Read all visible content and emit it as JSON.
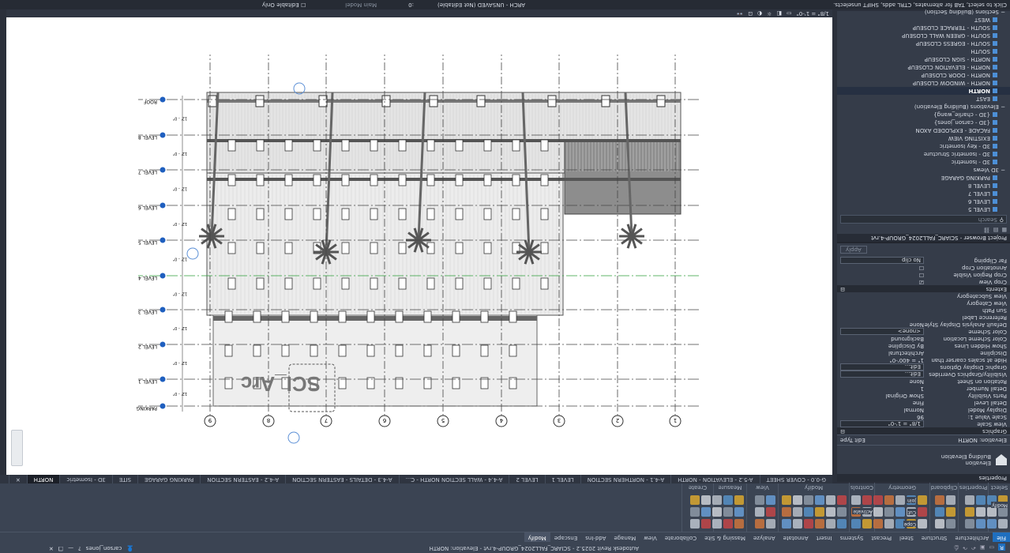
{
  "titlebar": {
    "title": "Autodesk Revit 2025.2 - SCIARC_FALL2024_GROUP-4.rvt - Elevation: NORTH",
    "user": "carson_jones"
  },
  "ribbon": {
    "tabs": [
      "File",
      "Architecture",
      "Structure",
      "Steel",
      "Precast",
      "Systems",
      "Insert",
      "Annotate",
      "Analyze",
      "Massing & Site",
      "Collaborate",
      "View",
      "Manage",
      "Add-Ins",
      "Enscape",
      "Modify"
    ],
    "active_tab": "Modify",
    "panels": [
      "Select",
      "Properties",
      "Clipboard",
      "Geometry",
      "Controls",
      "Modify",
      "View",
      "Measure",
      "Create"
    ],
    "labels": {
      "modify": "Modify",
      "cope": "Cope",
      "cut": "Cut",
      "join": "Join",
      "activate": "Activate"
    }
  },
  "view_tabs": [
    "G-0.0 - COVER SHEET",
    "A-5.2 - ELEVATION - NORTH",
    "A-4.1 - NORTHERN SECTION",
    "LEVEL 1",
    "LEVEL 2",
    "A-4.4 - WALL SECTION NORTH - C...",
    "A-4.3 - DETAILS - EASTERN SECTION",
    "A-4.2 - EASTERN SECTION",
    "PARKING GARAGE",
    "SITE",
    "3D - Isometric",
    "NORTH"
  ],
  "properties": {
    "header": "Properties",
    "type_family": "Elevation",
    "type_name": "Building Elevation",
    "instance": "Elevation: NORTH",
    "edit_type": "Edit Type",
    "sections": {
      "graphics": "Graphics",
      "extents": "Extents"
    },
    "graphics": [
      [
        "View Scale",
        "1/8\" = 1'-0\""
      ],
      [
        "Scale Value  1:",
        "96"
      ],
      [
        "Display Model",
        "Normal"
      ],
      [
        "Detail Level",
        "Fine"
      ],
      [
        "Parts Visibility",
        "Show Original"
      ],
      [
        "Detail Number",
        "1"
      ],
      [
        "Rotation on Sheet",
        "None"
      ],
      [
        "Visibility/Graphics Overrides",
        "Edit..."
      ],
      [
        "Graphic Display Options",
        "Edit..."
      ],
      [
        "Hide at scales coarser than",
        "1\" = 400'-0\""
      ],
      [
        "Discipline",
        "Architectural"
      ],
      [
        "Show Hidden Lines",
        "By Discipline"
      ],
      [
        "Color Scheme Location",
        "Background"
      ],
      [
        "Color Scheme",
        "<none>"
      ],
      [
        "Default Analysis Display Style",
        "None"
      ],
      [
        "Reference Label",
        ""
      ],
      [
        "Sun Path",
        ""
      ],
      [
        "View Category",
        ""
      ],
      [
        "View Subcategory",
        ""
      ]
    ],
    "extents": [
      [
        "Crop View",
        "☑"
      ],
      [
        "Crop Region Visible",
        "☐"
      ],
      [
        "Annotation Crop",
        "☐"
      ],
      [
        "Far Clipping",
        "No clip"
      ]
    ],
    "apply": "Apply"
  },
  "browser": {
    "header": "Project Browser - SCIARC_FALL2024_GROUP-4.rvt",
    "search": "Search",
    "items": [
      {
        "t": "i",
        "l": "LEVEL 5"
      },
      {
        "t": "i",
        "l": "LEVEL 6"
      },
      {
        "t": "i",
        "l": "LEVEL 7"
      },
      {
        "t": "i",
        "l": "LEVEL 8"
      },
      {
        "t": "i",
        "l": "PARKING GARAGE"
      },
      {
        "t": "g",
        "l": "− 3D Views"
      },
      {
        "t": "i",
        "l": "3D - Isometric"
      },
      {
        "t": "i",
        "l": "3D - Isometric Structure"
      },
      {
        "t": "i",
        "l": "3D - Key Isometric"
      },
      {
        "t": "i",
        "l": "EXISTING VIEW"
      },
      {
        "t": "i",
        "l": "FACADE - EXPLODED AXON"
      },
      {
        "t": "i",
        "l": "{3D - carson_jones}"
      },
      {
        "t": "i",
        "l": "{3D - charlie_wang}"
      },
      {
        "t": "g",
        "l": "− Elevations (Building Elevation)"
      },
      {
        "t": "i",
        "l": "EAST"
      },
      {
        "t": "s",
        "l": "NORTH"
      },
      {
        "t": "i",
        "l": "NORTH - WINDOW CLOSEUP"
      },
      {
        "t": "i",
        "l": "NORTH - DOOR CLOSEUP"
      },
      {
        "t": "i",
        "l": "NORTH - ELEVATION CLOSEUP"
      },
      {
        "t": "i",
        "l": "NORTH - SIGN CLOSEUP"
      },
      {
        "t": "i",
        "l": "SOUTH"
      },
      {
        "t": "i",
        "l": "SOUTH - EGRESS CLOSEUP"
      },
      {
        "t": "i",
        "l": "SOUTH - GREEN WALL CLOSEUP"
      },
      {
        "t": "i",
        "l": "SOUTH - TERRACE CLOSEUP"
      },
      {
        "t": "i",
        "l": "WEST"
      },
      {
        "t": "g",
        "l": "− Sections (Building Section)"
      }
    ]
  },
  "drawing": {
    "grids": [
      "1",
      "2",
      "3",
      "4",
      "5",
      "6",
      "7",
      "8",
      "9"
    ],
    "levels": [
      "PARKING",
      "LEVEL 1",
      "LEVEL 2",
      "LEVEL 3",
      "LEVEL 4",
      "LEVEL 5",
      "LEVEL 6",
      "LEVEL 7",
      "LEVEL 8",
      "ROOF"
    ],
    "dim": "12' - 0\"",
    "logo": "SCI_Arc"
  },
  "view_control": {
    "scale": "1/8\" = 1'-0\""
  },
  "status": {
    "hint": "Click to select, TAB for alternates, CTRL adds, SHIFT unselects.",
    "workset": "ARCH - UNSAVED (Not Editable)",
    "model": "Main Model",
    "editable_only": "Editable Only",
    "zero": ":0"
  }
}
